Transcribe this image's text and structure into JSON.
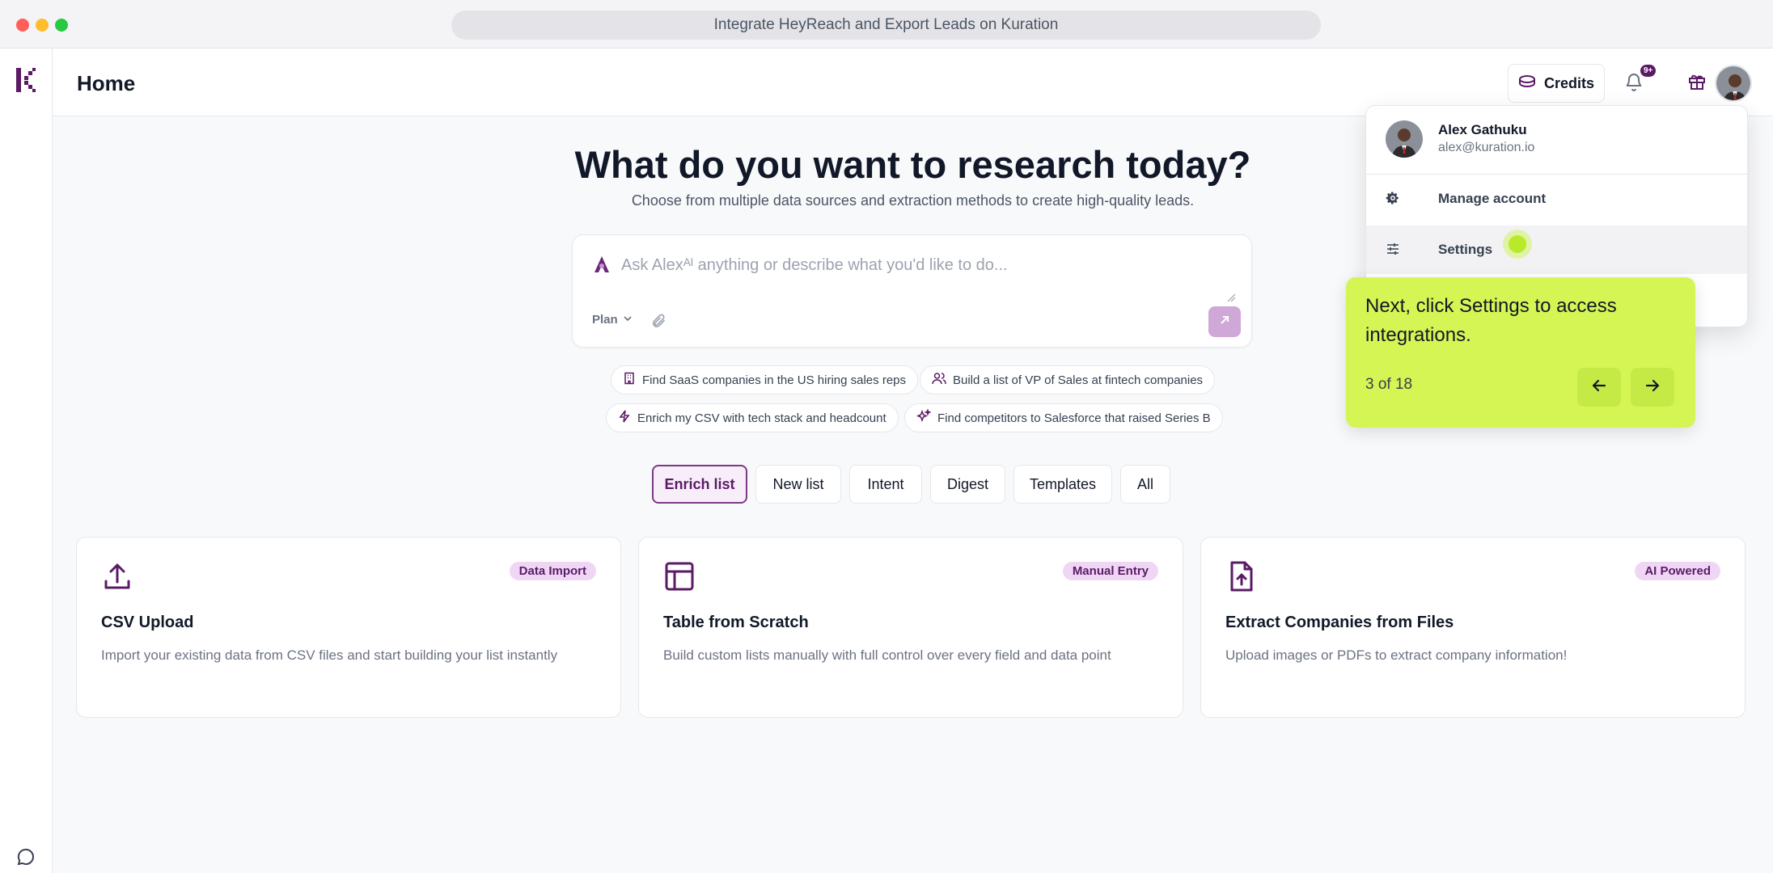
{
  "window": {
    "title": "Integrate HeyReach and Export Leads on Kuration"
  },
  "header": {
    "title": "Home",
    "credits_label": "Credits",
    "notification_badge": "9+"
  },
  "hero": {
    "title": "What do you want to research today?",
    "subtitle": "Choose from multiple data sources and extraction methods to create high-quality leads."
  },
  "ask": {
    "placeholder": "Ask Alexᴬᴵ anything or describe what you'd like to do...",
    "value": "",
    "plan_label": "Plan"
  },
  "suggestions": [
    {
      "label": "Find SaaS companies in the US hiring sales reps",
      "icon": "building-icon"
    },
    {
      "label": "Build a list of VP of Sales at fintech companies",
      "icon": "users-icon"
    },
    {
      "label": "Enrich my CSV with tech stack and headcount",
      "icon": "bolt-icon"
    },
    {
      "label": "Find competitors to Salesforce that raised Series B",
      "icon": "sparkles-icon"
    }
  ],
  "tabs": [
    {
      "label": "Enrich list",
      "active": true
    },
    {
      "label": "New list",
      "active": false
    },
    {
      "label": "Intent",
      "active": false
    },
    {
      "label": "Digest",
      "active": false
    },
    {
      "label": "Templates",
      "active": false
    },
    {
      "label": "All",
      "active": false
    }
  ],
  "cards": [
    {
      "icon": "upload-icon",
      "badge": "Data Import",
      "title": "CSV Upload",
      "description": "Import your existing data from CSV files and start building your list instantly"
    },
    {
      "icon": "table-icon",
      "badge": "Manual Entry",
      "title": "Table from Scratch",
      "description": "Build custom lists manually with full control over every field and data point"
    },
    {
      "icon": "file-upload-icon",
      "badge": "AI Powered",
      "title": "Extract Companies from Files",
      "description": "Upload images or PDFs to extract company information!"
    }
  ],
  "dropdown": {
    "user_name": "Alex Gathuku",
    "user_email": "alex@kuration.io",
    "items": [
      {
        "label": "Manage account",
        "icon": "gear-icon"
      },
      {
        "label": "Settings",
        "icon": "sliders-icon"
      }
    ]
  },
  "tour": {
    "text": "Next, click Settings to access integrations.",
    "step": "3 of 18"
  },
  "colors": {
    "brand": "#5b1a66",
    "badge_bg": "#f0d6f5",
    "tour_bg": "#d4f554",
    "send_button": "#cfa8d8"
  }
}
